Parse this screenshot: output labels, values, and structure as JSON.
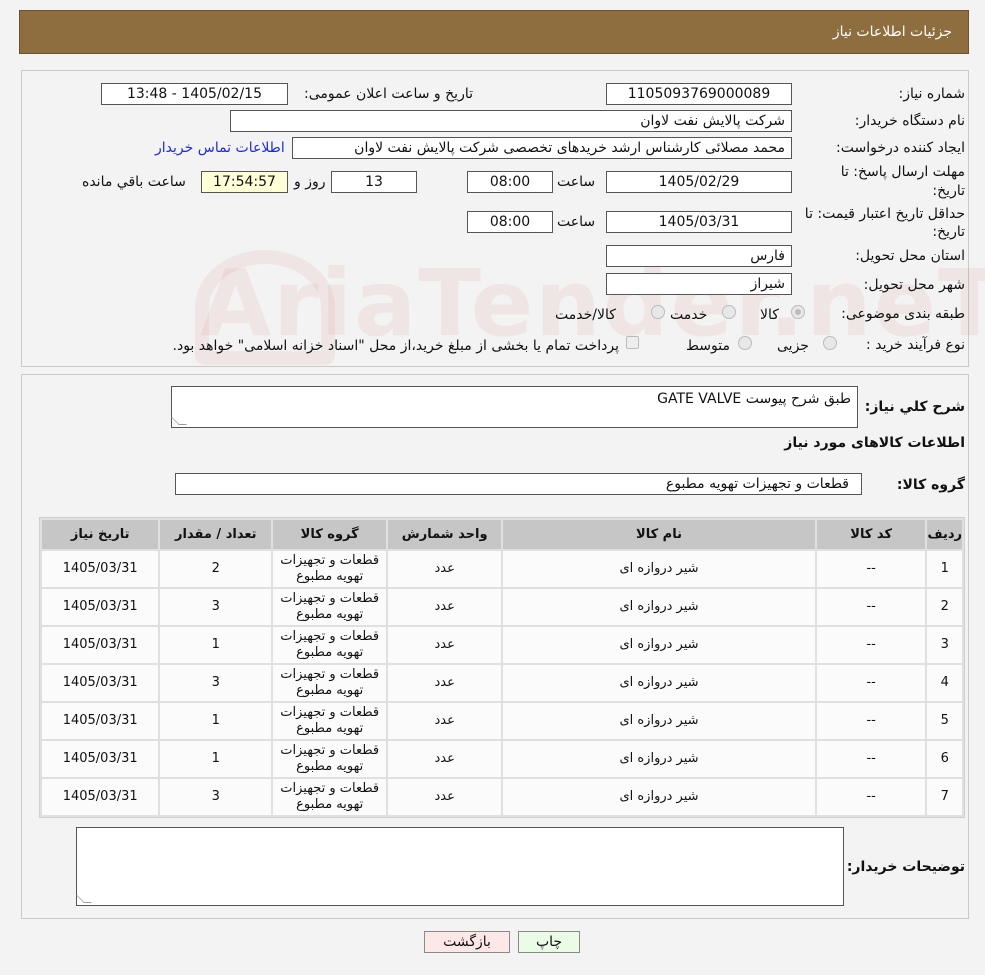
{
  "header": {
    "title": "جزئیات اطلاعات نیاز"
  },
  "form": {
    "need_number_label": "شماره نیاز:",
    "need_number": "1105093769000089",
    "announce_label": "تاریخ و ساعت اعلان عمومی:",
    "announce_value": "1405/02/15 - 13:48",
    "buyer_label": "نام دستگاه خریدار:",
    "buyer_value": "شرکت پالایش نفت لاوان",
    "creator_label": "ایجاد کننده درخواست:",
    "creator_value": "محمد مصلائی کارشناس ارشد خریدهای تخصصی شرکت پالایش نفت لاوان",
    "contact_link": "اطلاعات تماس خریدار",
    "deadline_label": "مهلت ارسال پاسخ: تا",
    "date_suffix": "تاریخ:",
    "deadline_date": "1405/02/29",
    "time_label": "ساعت",
    "deadline_time": "08:00",
    "days_value": "13",
    "days_label": "روز و",
    "remaining_time": "17:54:57",
    "remaining_label": "ساعت باقي مانده",
    "validity_label": "حداقل تاریخ اعتبار قیمت: تا",
    "validity_date": "1405/03/31",
    "validity_time": "08:00",
    "province_label": "استان محل تحویل:",
    "province_value": "فارس",
    "city_label": "شهر محل تحویل:",
    "city_value": "شیراز",
    "category_label": "طبقه بندی موضوعی:",
    "category_options": [
      "کالا",
      "خدمت",
      "کالا/خدمت"
    ],
    "process_label": "نوع فرآیند خرید :",
    "process_options": [
      "جزیی",
      "متوسط"
    ],
    "payment_note": "پرداخت تمام یا بخشی از مبلغ خرید،از محل \"اسناد خزانه اسلامی\" خواهد بود."
  },
  "details": {
    "summary_label": "شرح کلي نياز:",
    "summary_value": "GATE VALVE طبق شرح پیوست",
    "items_title": "اطلاعات کالاهای مورد نیاز",
    "group_label": "گروه کالا:",
    "group_value": "قطعات و تجهیزات تهویه مطبوع",
    "buyer_notes_label": "توضیحات خریدار:"
  },
  "table": {
    "headers": [
      "ردیف",
      "کد کالا",
      "نام کالا",
      "واحد شمارش",
      "گروه کالا",
      "تعداد / مقدار",
      "تاریخ نیاز"
    ],
    "rows": [
      [
        "1",
        "--",
        "شیر دروازه ای",
        "عدد",
        "قطعات و تجهیزات تهویه مطبوع",
        "2",
        "1405/03/31"
      ],
      [
        "2",
        "--",
        "شیر دروازه ای",
        "عدد",
        "قطعات و تجهیزات تهویه مطبوع",
        "3",
        "1405/03/31"
      ],
      [
        "3",
        "--",
        "شیر دروازه ای",
        "عدد",
        "قطعات و تجهیزات تهویه مطبوع",
        "1",
        "1405/03/31"
      ],
      [
        "4",
        "--",
        "شیر دروازه ای",
        "عدد",
        "قطعات و تجهیزات تهویه مطبوع",
        "3",
        "1405/03/31"
      ],
      [
        "5",
        "--",
        "شیر دروازه ای",
        "عدد",
        "قطعات و تجهیزات تهویه مطبوع",
        "1",
        "1405/03/31"
      ],
      [
        "6",
        "--",
        "شیر دروازه ای",
        "عدد",
        "قطعات و تجهیزات تهویه مطبوع",
        "1",
        "1405/03/31"
      ],
      [
        "7",
        "--",
        "شیر دروازه ای",
        "عدد",
        "قطعات و تجهیزات تهویه مطبوع",
        "3",
        "1405/03/31"
      ]
    ]
  },
  "buttons": {
    "print": "چاپ",
    "back": "بازگشت"
  },
  "watermark": "AriaTender.neT"
}
